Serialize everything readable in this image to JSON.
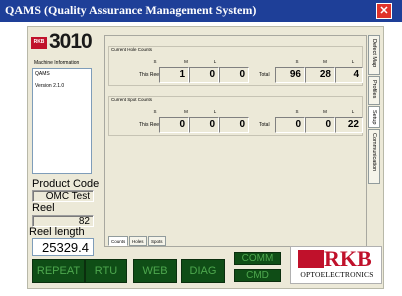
{
  "window": {
    "title": "QAMS (Quality Assurance Management System)"
  },
  "logo": {
    "mark": "RKB",
    "model": "3010"
  },
  "machine_info": {
    "label": "Machine Information",
    "lines": [
      "QAMS",
      "Version 2.1.0"
    ]
  },
  "product_code": {
    "label": "Product Code",
    "value": "OMC Test"
  },
  "reel": {
    "label": "Reel",
    "value": "82"
  },
  "reel_length": {
    "label": "Reel length",
    "value": "25329.4"
  },
  "hole_counts": {
    "title": "Current Hole Counts",
    "col_s": "S",
    "col_m": "M",
    "col_l": "L",
    "this_reel_label": "This Reel",
    "total_label": "Total",
    "this_reel": {
      "s": "1",
      "m": "0",
      "l": "0"
    },
    "total": {
      "s": "96",
      "m": "28",
      "l": "4"
    }
  },
  "spot_counts": {
    "title": "Current Spot Counts",
    "col_s": "S",
    "col_m": "M",
    "col_l": "L",
    "this_reel_label": "This Reel",
    "total_label": "Total",
    "this_reel": {
      "s": "0",
      "m": "0",
      "l": "0"
    },
    "total": {
      "s": "0",
      "m": "0",
      "l": "22"
    }
  },
  "bottom_tabs": [
    "Counts",
    "Holes",
    "Spots"
  ],
  "side_tabs": [
    "Defect Map",
    "Profiles",
    "Setup",
    "Communication"
  ],
  "buttons": {
    "repeat": "REPEAT",
    "rtu": "RTU",
    "web": "WEB",
    "diag": "DIAG",
    "comm": "COMM",
    "cmd": "CMD"
  },
  "brand": {
    "name": "RKB",
    "sub": "OPTOELECTRONICS"
  },
  "colors": {
    "titlebar": "#1e3f98",
    "brand_red": "#c0112b",
    "button_green": "#0f4d16",
    "button_text": "#4ea84e"
  }
}
